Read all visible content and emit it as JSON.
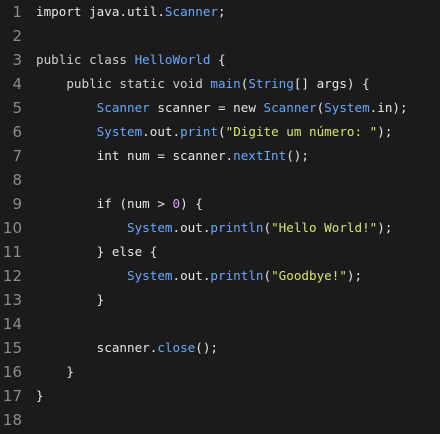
{
  "editor": {
    "lines": [
      {
        "num": "1",
        "tokens": [
          {
            "t": "import java.util.",
            "c": "t-id"
          },
          {
            "t": "Scanner",
            "c": "t-cls"
          },
          {
            "t": ";",
            "c": "t-id"
          }
        ]
      },
      {
        "num": "2",
        "tokens": []
      },
      {
        "num": "3",
        "tokens": [
          {
            "t": "public class ",
            "c": "t-kw"
          },
          {
            "t": "HelloWorld",
            "c": "t-cls"
          },
          {
            "t": " {",
            "c": "t-id"
          }
        ]
      },
      {
        "num": "4",
        "tokens": [
          {
            "t": "    public static void ",
            "c": "t-kw"
          },
          {
            "t": "main",
            "c": "t-fn"
          },
          {
            "t": "(",
            "c": "t-id"
          },
          {
            "t": "String",
            "c": "t-cls"
          },
          {
            "t": "[] args) {",
            "c": "t-id"
          }
        ]
      },
      {
        "num": "5",
        "tokens": [
          {
            "t": "        ",
            "c": "t-id"
          },
          {
            "t": "Scanner",
            "c": "t-cls"
          },
          {
            "t": " scanner = new ",
            "c": "t-id"
          },
          {
            "t": "Scanner",
            "c": "t-cls"
          },
          {
            "t": "(",
            "c": "t-id"
          },
          {
            "t": "System",
            "c": "t-cls"
          },
          {
            "t": ".in);",
            "c": "t-id"
          }
        ]
      },
      {
        "num": "6",
        "tokens": [
          {
            "t": "        ",
            "c": "t-id"
          },
          {
            "t": "System",
            "c": "t-cls"
          },
          {
            "t": ".out.",
            "c": "t-id"
          },
          {
            "t": "print",
            "c": "t-fn"
          },
          {
            "t": "(",
            "c": "t-id"
          },
          {
            "t": "\"Digite um número: \"",
            "c": "t-str"
          },
          {
            "t": ");",
            "c": "t-id"
          }
        ]
      },
      {
        "num": "7",
        "tokens": [
          {
            "t": "        int num = scanner.",
            "c": "t-id"
          },
          {
            "t": "nextInt",
            "c": "t-fn"
          },
          {
            "t": "();",
            "c": "t-id"
          }
        ]
      },
      {
        "num": "8",
        "tokens": []
      },
      {
        "num": "9",
        "tokens": [
          {
            "t": "        if (num > ",
            "c": "t-id"
          },
          {
            "t": "0",
            "c": "t-num"
          },
          {
            "t": ") {",
            "c": "t-id"
          }
        ]
      },
      {
        "num": "10",
        "tokens": [
          {
            "t": "            ",
            "c": "t-id"
          },
          {
            "t": "System",
            "c": "t-cls"
          },
          {
            "t": ".out.",
            "c": "t-id"
          },
          {
            "t": "println",
            "c": "t-fn"
          },
          {
            "t": "(",
            "c": "t-id"
          },
          {
            "t": "\"Hello World!\"",
            "c": "t-str"
          },
          {
            "t": ");",
            "c": "t-id"
          }
        ]
      },
      {
        "num": "11",
        "tokens": [
          {
            "t": "        } else {",
            "c": "t-id"
          }
        ]
      },
      {
        "num": "12",
        "tokens": [
          {
            "t": "            ",
            "c": "t-id"
          },
          {
            "t": "System",
            "c": "t-cls"
          },
          {
            "t": ".out.",
            "c": "t-id"
          },
          {
            "t": "println",
            "c": "t-fn"
          },
          {
            "t": "(",
            "c": "t-id"
          },
          {
            "t": "\"Goodbye!\"",
            "c": "t-str"
          },
          {
            "t": ");",
            "c": "t-id"
          }
        ]
      },
      {
        "num": "13",
        "tokens": [
          {
            "t": "        }",
            "c": "t-id"
          }
        ]
      },
      {
        "num": "14",
        "tokens": []
      },
      {
        "num": "15",
        "tokens": [
          {
            "t": "        scanner.",
            "c": "t-id"
          },
          {
            "t": "close",
            "c": "t-fn"
          },
          {
            "t": "();",
            "c": "t-id"
          }
        ]
      },
      {
        "num": "16",
        "tokens": [
          {
            "t": "    }",
            "c": "t-id"
          }
        ]
      },
      {
        "num": "17",
        "tokens": [
          {
            "t": "}",
            "c": "t-id"
          }
        ]
      },
      {
        "num": "18",
        "tokens": []
      }
    ]
  }
}
